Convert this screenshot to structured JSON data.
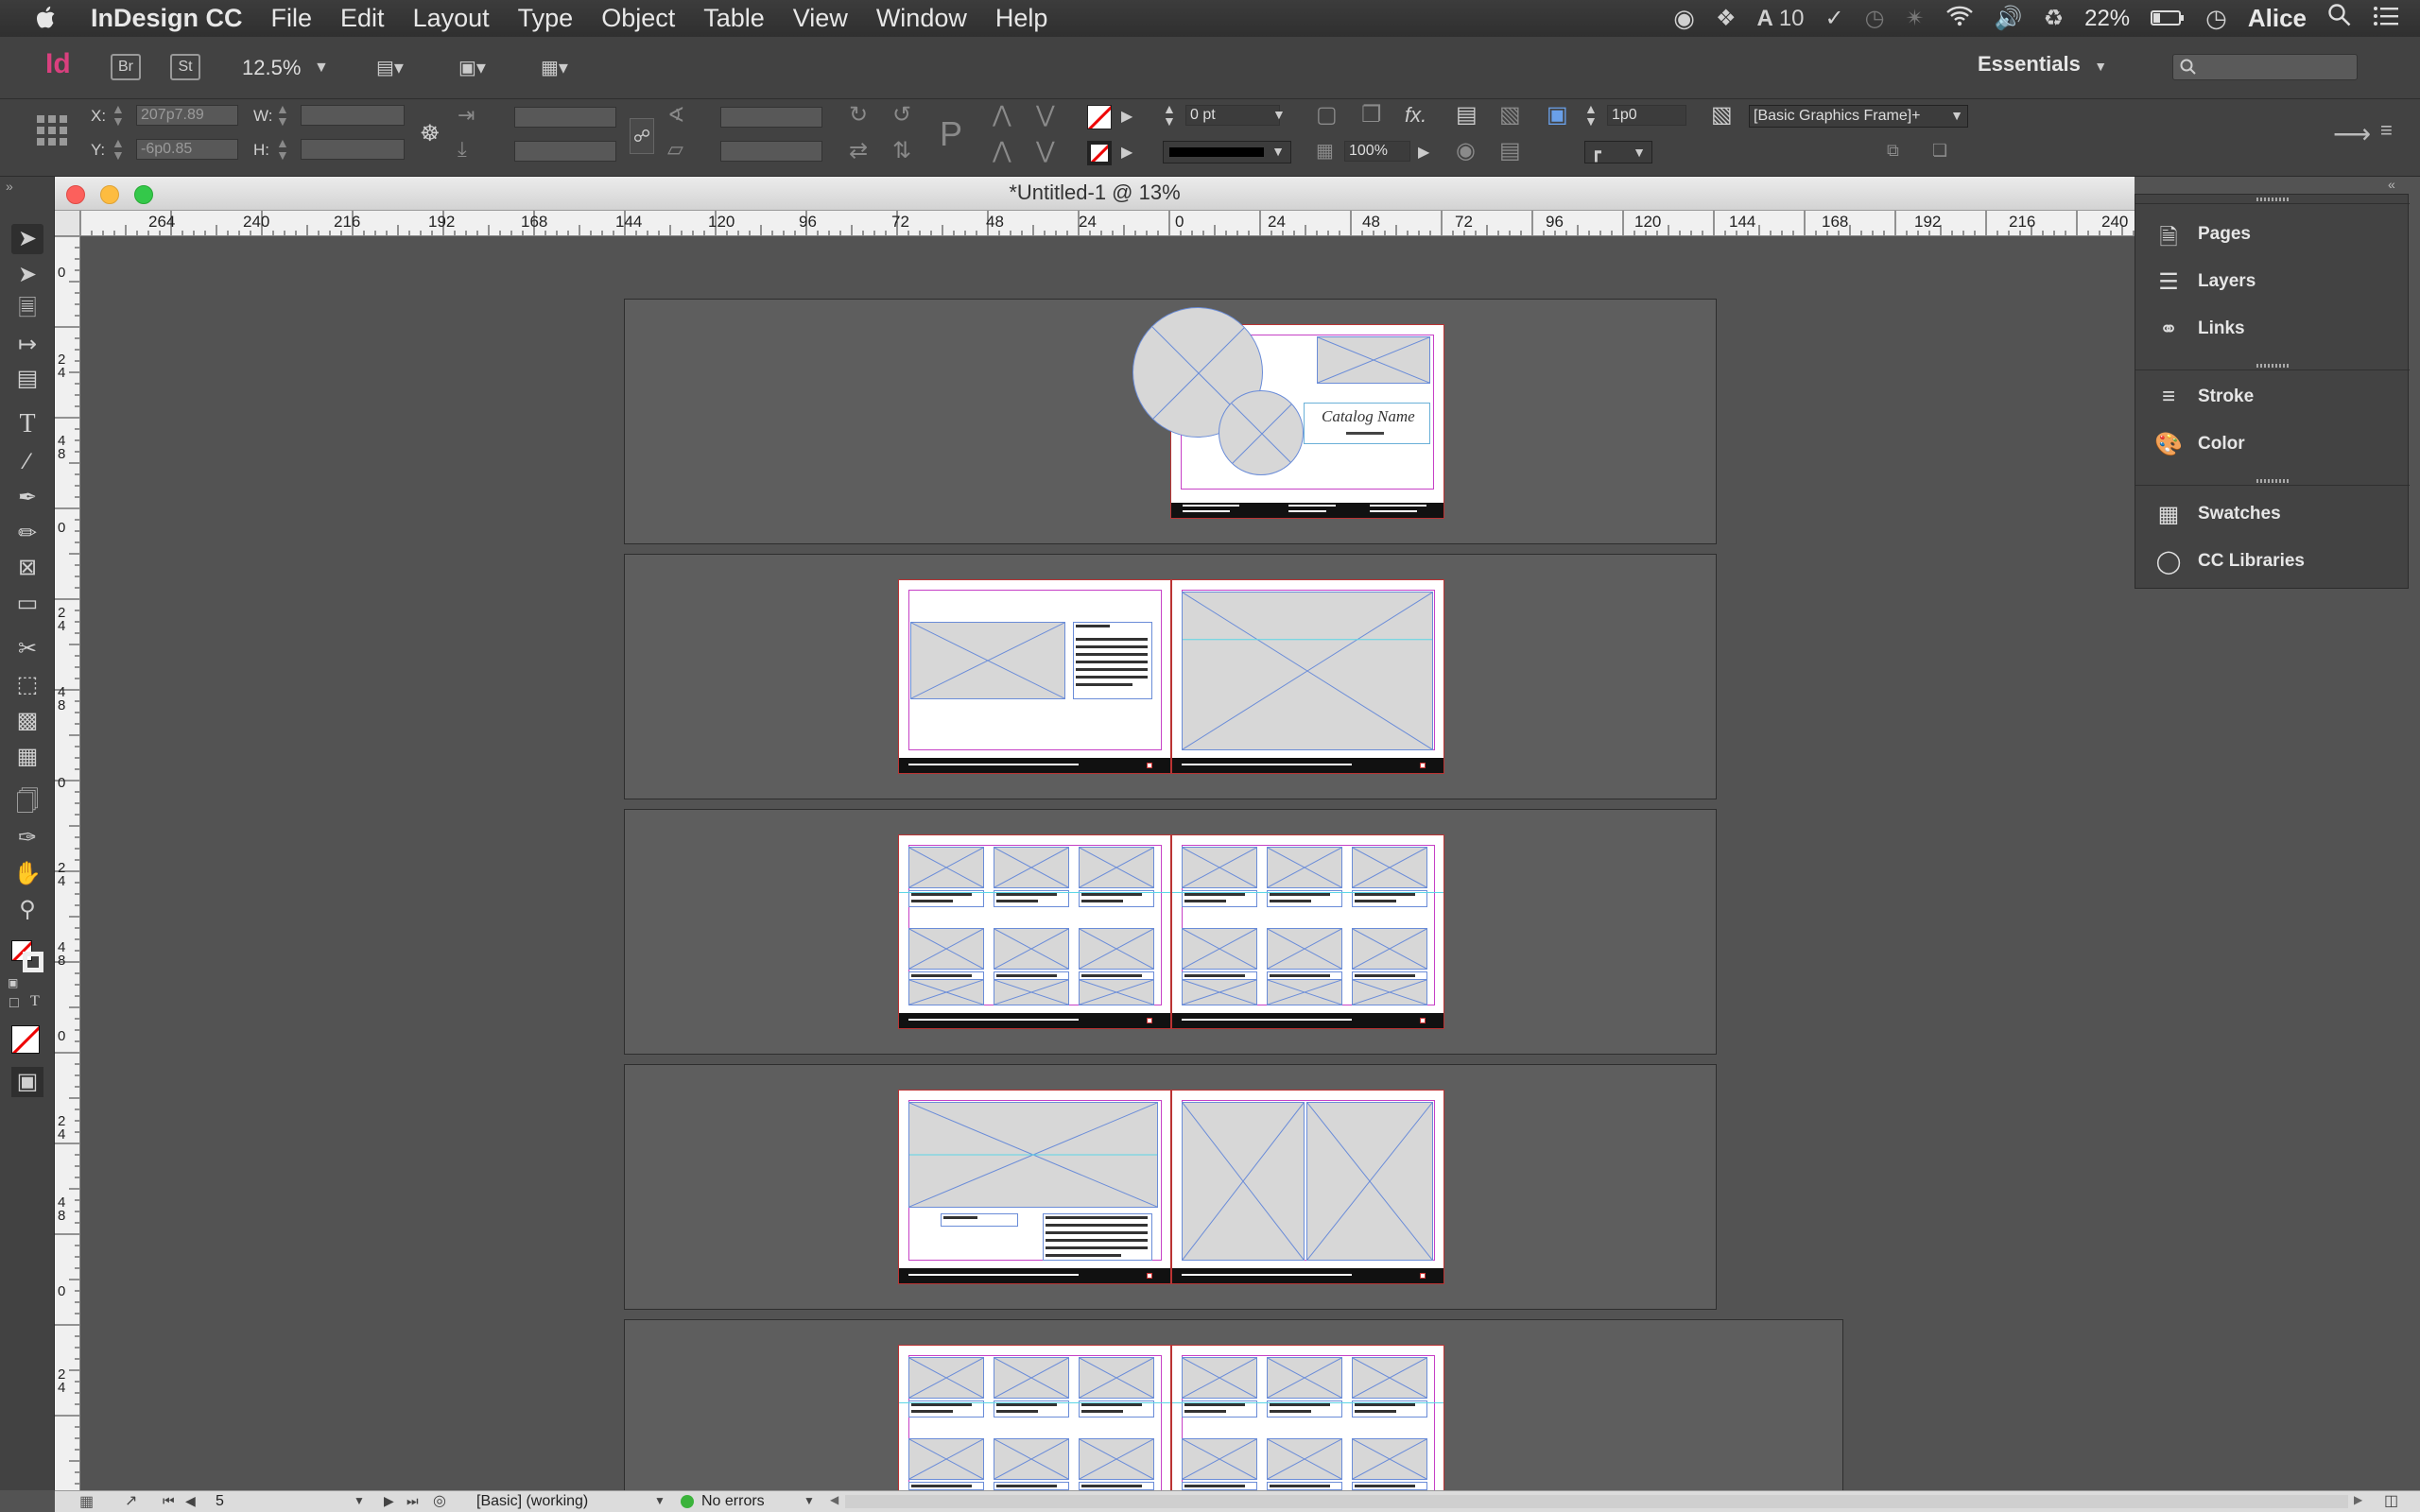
{
  "menubar": {
    "app_name": "InDesign CC",
    "items": [
      "File",
      "Edit",
      "Layout",
      "Type",
      "Object",
      "Table",
      "View",
      "Window",
      "Help"
    ],
    "status": {
      "adobe_count": "10",
      "battery": "22%",
      "user": "Alice"
    }
  },
  "appbar": {
    "logo": "Id",
    "bridge": "Br",
    "stock": "St",
    "zoom": "12.5%",
    "workspace": "Essentials"
  },
  "control": {
    "x_label": "X:",
    "x_value": "207p7.89",
    "y_label": "Y:",
    "y_value": "-6p0.85",
    "w_label": "W:",
    "h_label": "H:",
    "stroke_weight": "0 pt",
    "opacity": "100%",
    "gap": "1p0",
    "object_style": "[Basic Graphics Frame]+"
  },
  "document": {
    "title": "*Untitled-1 @ 13%",
    "ruler_h": [
      "264",
      "240",
      "216",
      "192",
      "168",
      "144",
      "120",
      "96",
      "72",
      "48",
      "24",
      "0",
      "24",
      "48",
      "72",
      "96",
      "120",
      "144",
      "168",
      "192",
      "216",
      "240"
    ],
    "ruler_v": [
      "0",
      "2",
      "4",
      "4",
      "8",
      "0",
      "2",
      "4",
      "4",
      "8",
      "0",
      "2",
      "4",
      "4",
      "8",
      "0",
      "2",
      "4",
      "4",
      "8",
      "0",
      "2",
      "4"
    ],
    "catalog_name": "Catalog Name"
  },
  "status": {
    "page_number": "5",
    "preflight_profile": "[Basic] (working)",
    "errors": "No errors"
  },
  "panels": {
    "group1": [
      "Pages",
      "Layers",
      "Links"
    ],
    "group2": [
      "Stroke",
      "Color"
    ],
    "group3": [
      "Swatches",
      "CC Libraries"
    ]
  },
  "colors": {
    "ui_dark": "#424242",
    "pasteboard": "#535353",
    "frame_stroke": "#6a8cd8",
    "margin": "#c640c6",
    "logo": "#d9407e"
  }
}
